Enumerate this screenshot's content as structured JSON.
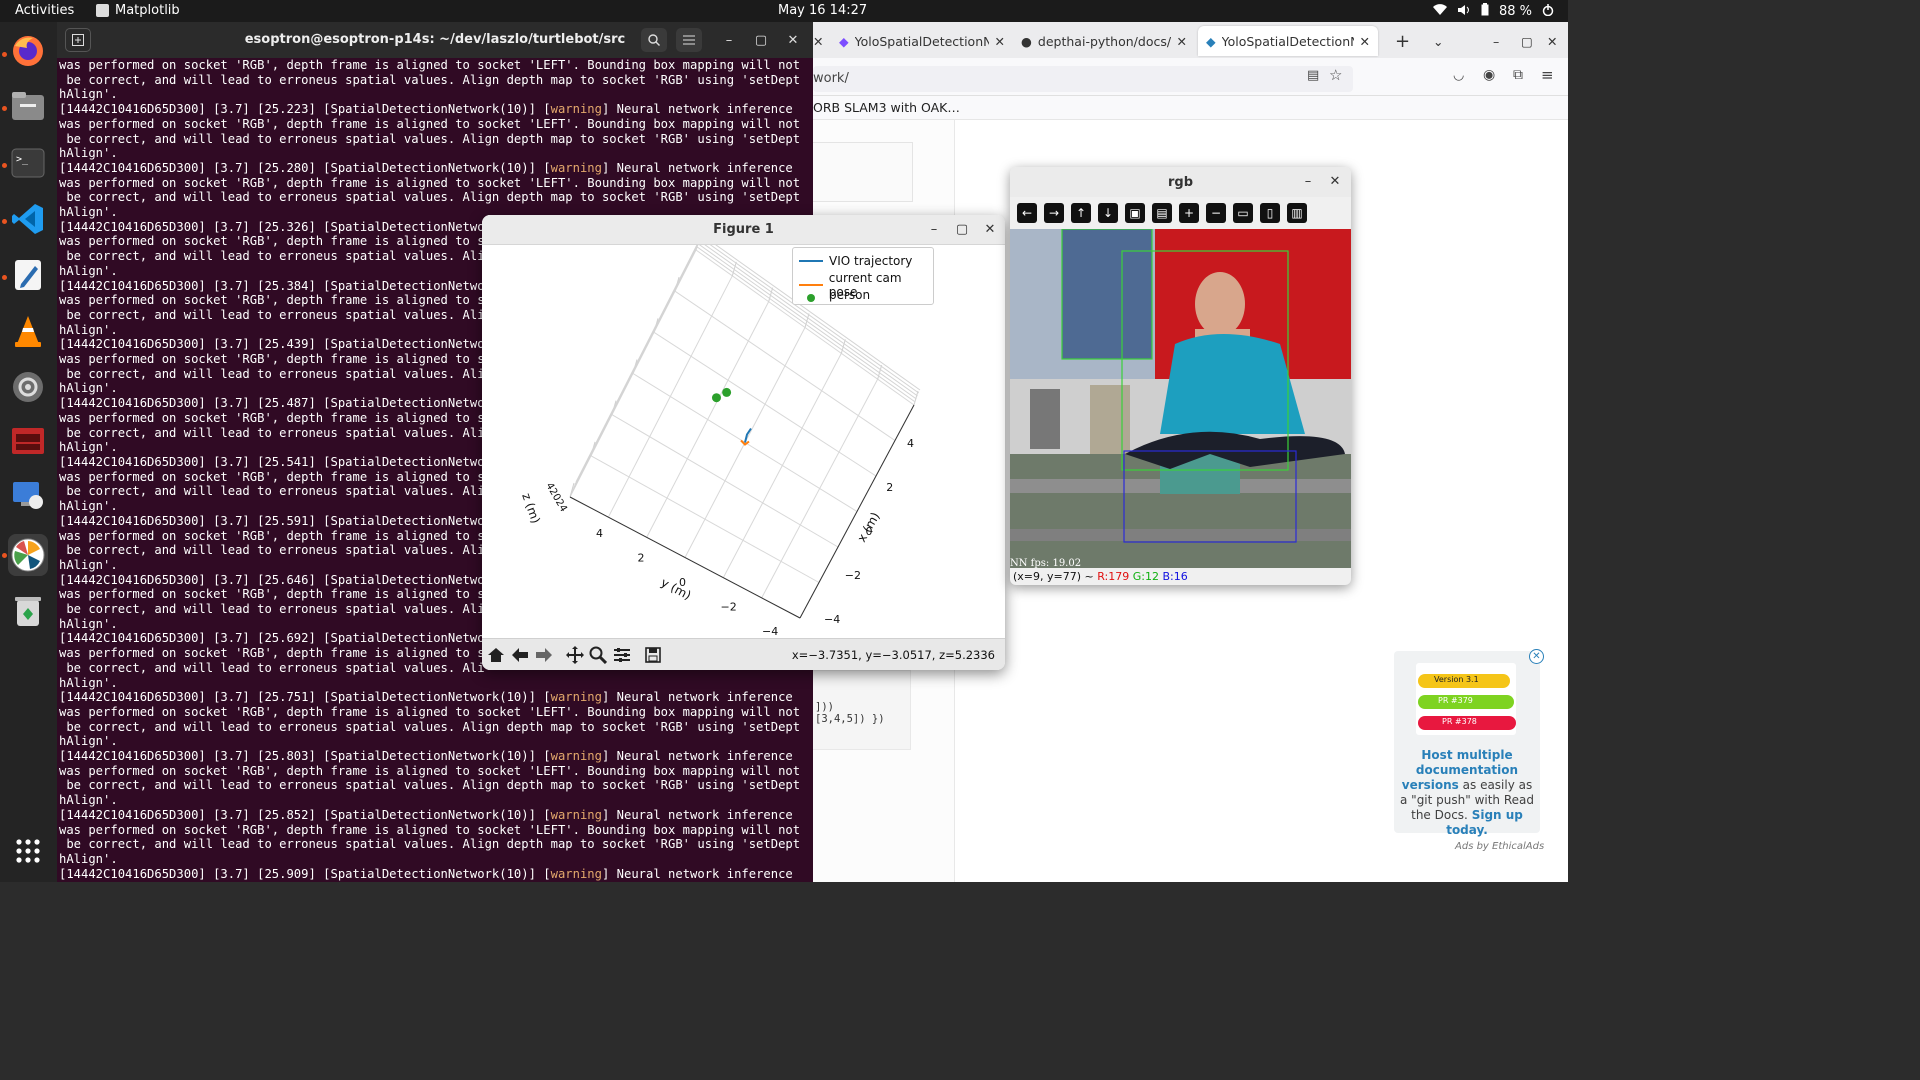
{
  "topbar": {
    "activities": "Activities",
    "app_name": "Matplotlib",
    "clock": "May 16  14:27",
    "battery": "88 %"
  },
  "dock": {
    "items": [
      "firefox-icon",
      "files-icon",
      "terminal-icon",
      "vscode-icon",
      "text-editor-icon",
      "vlc-icon",
      "settings-icon",
      "screen-app-icon",
      "remote-desktop-icon",
      "matplotlib-icon",
      "trash-icon",
      "app-grid-icon"
    ]
  },
  "terminal": {
    "title": "esoptron@esoptron-p14s: ~/dev/laszlo/turtlebot/src",
    "head_lines": [
      "was performed on socket 'RGB', depth frame is aligned to socket 'LEFT'. Bounding box mapping will not",
      " be correct, and will lead to erroneus spatial values. Align depth map to socket 'RGB' using 'setDept",
      "hAlign'."
    ],
    "entries": [
      {
        "prefix": "[14442C10416D65D300] [3.7] [25.223] [SpatialDetectionNetwork(10)] [",
        "level": "warning",
        "suffix": "] Neural network inference"
      },
      {
        "prefix": "[14442C10416D65D300] [3.7] [25.280] [SpatialDetectionNetwork(10)] [",
        "level": "warning",
        "suffix": "] Neural network inference"
      },
      {
        "prefix": "[14442C10416D65D300] [3.7] [25.326] [SpatialDetectionNetwo",
        "level": "",
        "suffix": ""
      },
      {
        "prefix": "[14442C10416D65D300] [3.7] [25.384] [SpatialDetectionNetwo",
        "level": "",
        "suffix": ""
      },
      {
        "prefix": "[14442C10416D65D300] [3.7] [25.439] [SpatialDetectionNetwo",
        "level": "",
        "suffix": ""
      },
      {
        "prefix": "[14442C10416D65D300] [3.7] [25.487] [SpatialDetectionNetwo",
        "level": "",
        "suffix": ""
      },
      {
        "prefix": "[14442C10416D65D300] [3.7] [25.541] [SpatialDetectionNetwo",
        "level": "",
        "suffix": ""
      },
      {
        "prefix": "[14442C10416D65D300] [3.7] [25.591] [SpatialDetectionNetwo",
        "level": "",
        "suffix": ""
      },
      {
        "prefix": "[14442C10416D65D300] [3.7] [25.646] [SpatialDetectionNetwo",
        "level": "",
        "suffix": ""
      },
      {
        "prefix": "[14442C10416D65D300] [3.7] [25.692] [SpatialDetectionNetwo",
        "level": "",
        "suffix": ""
      },
      {
        "prefix": "[14442C10416D65D300] [3.7] [25.751] [SpatialDetectionNetwork(10)] [",
        "level": "warning",
        "suffix": "] Neural network inference"
      },
      {
        "prefix": "[14442C10416D65D300] [3.7] [25.803] [SpatialDetectionNetwork(10)] [",
        "level": "warning",
        "suffix": "] Neural network inference"
      },
      {
        "prefix": "[14442C10416D65D300] [3.7] [25.852] [SpatialDetectionNetwork(10)] [",
        "level": "warning",
        "suffix": "] Neural network inference"
      },
      {
        "prefix": "[14442C10416D65D300] [3.7] [25.909] [SpatialDetectionNetwork(10)] [",
        "level": "warning",
        "suffix": "] Neural network inference"
      }
    ],
    "body_lines_full": [
      "was performed on socket 'RGB', depth frame is aligned to socket 'LEFT'. Bounding box mapping will not",
      " be correct, and will lead to erroneus spatial values. Align depth map to socket 'RGB' using 'setDept",
      "hAlign'."
    ],
    "body_lines_cut": [
      "was performed on socket 'RGB', depth frame is aligned to s",
      " be correct, and will lead to erroneus spatial values. Ali",
      "hAlign'."
    ]
  },
  "browser": {
    "tabs": [
      {
        "label": "YoloSpatialDetectionNet"
      },
      {
        "label": "depthai-python/docs/sou"
      },
      {
        "label": "YoloSpatialDetectionNet"
      }
    ],
    "url": "work/",
    "bookmark": "ORB SLAM3 with OAK…",
    "code_line1": "]))",
    "code_line2": "[3,4,5]) })"
  },
  "figure": {
    "title": "Figure 1",
    "coord_readout": "x=−3.7351, y=−3.0517, z=5.2336",
    "legend": [
      {
        "label": "VIO trajectory",
        "color": "#1f77b4",
        "kind": "line"
      },
      {
        "label": "current cam pose",
        "color": "#ff7f0e",
        "kind": "line"
      },
      {
        "label": "person",
        "color": "#2ca02c",
        "kind": "dot"
      }
    ],
    "axes": {
      "x_label": "x (m)",
      "y_label": "y (m)",
      "z_label": "z (m)",
      "x_ticks": [
        "4",
        "2",
        "0",
        "−2",
        "−4"
      ],
      "y_ticks": [
        "4",
        "2",
        "0",
        "−2",
        "−4"
      ],
      "z_ticks": "42024"
    }
  },
  "chart_data": {
    "type": "scatter",
    "title": "",
    "xlabel": "x (m)",
    "ylabel": "y (m)",
    "zlabel": "z (m)",
    "xlim": [
      -4,
      4
    ],
    "ylim": [
      -4,
      4
    ],
    "legend_placement": "top-right",
    "grid": true,
    "series": [
      {
        "name": "VIO trajectory",
        "points": [
          [
            0.0,
            0.0,
            0.0
          ],
          [
            0.1,
            0.05,
            0.3
          ]
        ]
      },
      {
        "name": "current cam pose",
        "points": [
          [
            0.0,
            0.0,
            0.0
          ]
        ]
      },
      {
        "name": "person",
        "points": [
          [
            -0.7,
            1.4,
            0.0
          ],
          [
            -1.0,
            1.2,
            0.0
          ]
        ]
      }
    ]
  },
  "rgb": {
    "title": "rgb",
    "status_prefix": "(x=9, y=77) ~ ",
    "r": "R:179",
    "g": "G:12",
    "b": "B:16",
    "nn_fps": "NN fps: 19.02"
  },
  "ad": {
    "pill1": "Version 3.1",
    "pill2": "PR #379",
    "pill3": "PR #378",
    "text_bold": "Host multiple documentation versions",
    "text_plain": " as easily as a \"git push\" with Read the Docs. ",
    "cta": "Sign up today.",
    "by": "Ads by EthicalAds"
  }
}
